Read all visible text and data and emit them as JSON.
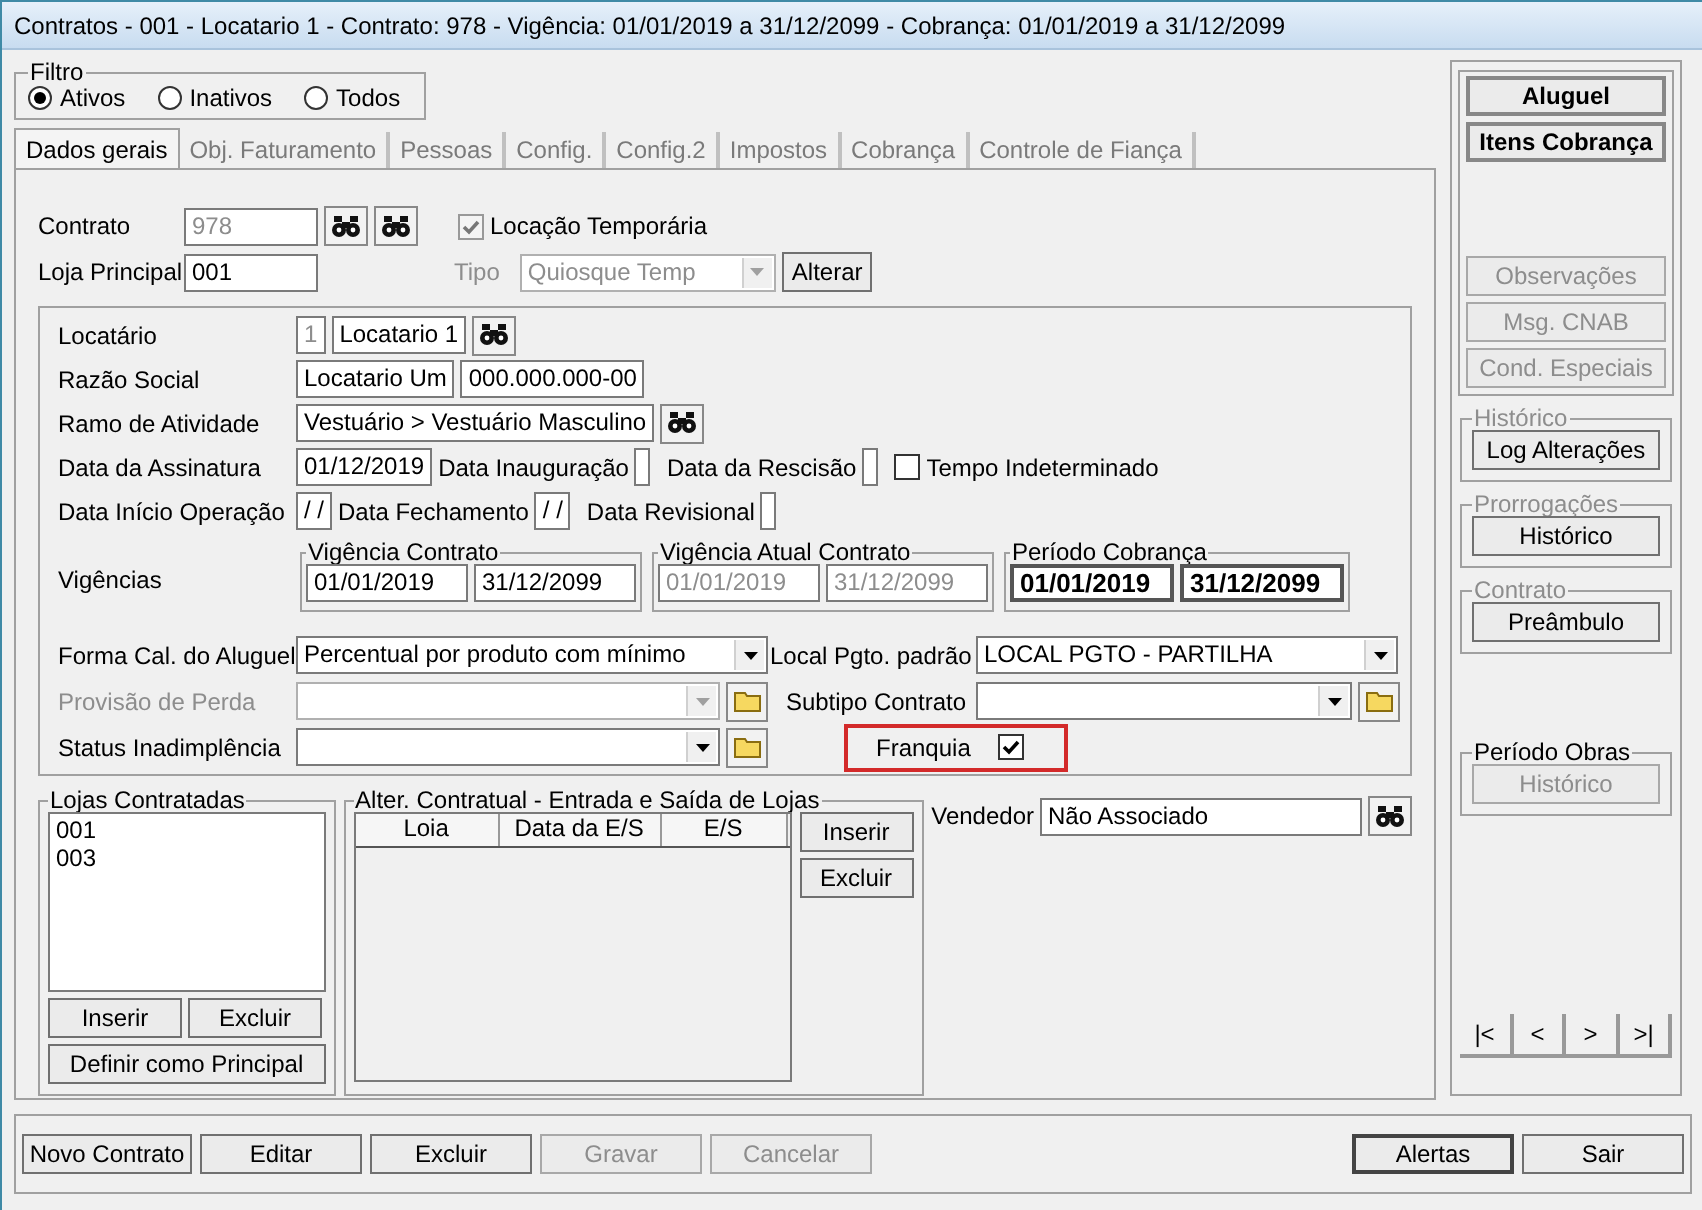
{
  "window": {
    "title": "Contratos - 001 - Locatario 1 - Contrato: 978 - Vigência: 01/01/2019 a 31/12/2099 - Cobrança: 01/01/2019 a 31/12/2099"
  },
  "filter": {
    "title": "Filtro",
    "options": [
      {
        "label": "Ativos",
        "selected": true
      },
      {
        "label": "Inativos",
        "selected": false
      },
      {
        "label": "Todos",
        "selected": false
      }
    ]
  },
  "tabs": [
    {
      "label": "Dados gerais",
      "selected": true
    },
    {
      "label": "Obj. Faturamento",
      "selected": false
    },
    {
      "label": "Pessoas",
      "selected": false
    },
    {
      "label": "Config.",
      "selected": false
    },
    {
      "label": "Config.2",
      "selected": false
    },
    {
      "label": "Impostos",
      "selected": false
    },
    {
      "label": "Cobrança",
      "selected": false
    },
    {
      "label": "Controle de Fiança",
      "selected": false
    }
  ],
  "contract": {
    "label": "Contrato",
    "number": "978",
    "temporary": {
      "label": "Locação Temporária",
      "checked": true
    },
    "main_store_label": "Loja Principal",
    "main_store": "001",
    "type_label": "Tipo",
    "type": "Quiosque Temp",
    "change_button": "Alterar"
  },
  "tenant": {
    "label": "Locatário",
    "code": "1",
    "name": "Locatario 1"
  },
  "company": {
    "label": "Razão Social",
    "name": "Locatario Um",
    "document": "000.000.000-00"
  },
  "activity": {
    "label": "Ramo de Atividade",
    "value": "Vestuário > Vestuário Masculino"
  },
  "date_rows": [
    [
      {
        "label": "Data da Assinatura",
        "value": "01/12/2019"
      },
      {
        "label": "Data Inauguração"
      },
      {
        "label": "Data da Rescisão"
      }
    ],
    [
      {
        "label": "Data Início Operação",
        "value": "/ /"
      },
      {
        "label": "Data Fechamento",
        "value": "/ /"
      },
      {
        "label": "Data Revisional"
      }
    ]
  ],
  "indeterminate": {
    "label": "Tempo Indeterminado",
    "checked": false
  },
  "validity": {
    "label": "Vigências",
    "groups": [
      {
        "title": "Vigência Contrato",
        "start": "01/01/2019",
        "end": "31/12/2099",
        "kind": "normal"
      },
      {
        "title": "Vigência Atual Contrato",
        "start": "01/01/2019",
        "end": "31/12/2099",
        "kind": "disabled"
      },
      {
        "title": "Período Cobrança",
        "start": "01/01/2019",
        "end": "31/12/2099",
        "kind": "bold"
      }
    ]
  },
  "left_selects": [
    {
      "label": "Forma Cal. do Aluguel",
      "value": "Percentual por produto com mínimo",
      "disabled": false,
      "kind": "plain"
    },
    {
      "label": "Provisão de Perda",
      "disabled": true,
      "kind": "folder"
    },
    {
      "label": "Status Inadimplência",
      "disabled": false,
      "kind": "folder"
    }
  ],
  "right_selects": [
    {
      "label": "Local Pgto. padrão",
      "value": "LOCAL PGTO - PARTILHA",
      "kind": "plain"
    },
    {
      "label": "Subtipo Contrato",
      "kind": "folder"
    }
  ],
  "franchise": {
    "label": "Franquia",
    "checked": true,
    "highlighted": true
  },
  "stores": {
    "title": "Lojas Contratadas",
    "items": [
      "001",
      "003"
    ],
    "buttons": [
      "Inserir",
      "Excluir"
    ],
    "main_button": "Definir como Principal"
  },
  "changes": {
    "title": "Alter. Contratual - Entrada e Saída de Lojas",
    "columns": [
      "Loia",
      "Data da E/S",
      "E/S"
    ],
    "buttons": [
      "Inserir",
      "Excluir"
    ]
  },
  "seller": {
    "label": "Vendedor",
    "value": "Não Associado"
  },
  "side": {
    "main_buttons": [
      "Aluguel",
      "Itens Cobrança"
    ],
    "buttons": [
      {
        "label": "Observações",
        "disabled": true
      },
      {
        "label": "Msg. CNAB",
        "disabled": true
      },
      {
        "label": "Cond. Especiais",
        "disabled": true
      }
    ],
    "groups": [
      {
        "title": "Histórico",
        "title_disabled": true,
        "button": "Log Alterações",
        "button_disabled": false
      },
      {
        "title": "Prorrogações",
        "title_disabled": true,
        "button": "Histórico",
        "button_disabled": false
      },
      {
        "title": "Contrato",
        "title_disabled": true,
        "button": "Preâmbulo",
        "button_disabled": false
      },
      {
        "title": "Período Obras",
        "title_disabled": false,
        "button": "Histórico",
        "button_disabled": true
      }
    ],
    "nav": [
      "|<",
      "<",
      ">",
      ">|"
    ]
  },
  "footer": {
    "buttons": [
      {
        "label": "Novo Contrato",
        "disabled": false
      },
      {
        "label": "Editar",
        "disabled": false
      },
      {
        "label": "Excluir",
        "disabled": false
      },
      {
        "label": "Gravar",
        "disabled": true
      },
      {
        "label": "Cancelar",
        "disabled": true
      }
    ],
    "right_buttons": [
      {
        "label": "Alertas",
        "focused": true
      },
      {
        "label": "Sair",
        "focused": false
      }
    ]
  }
}
